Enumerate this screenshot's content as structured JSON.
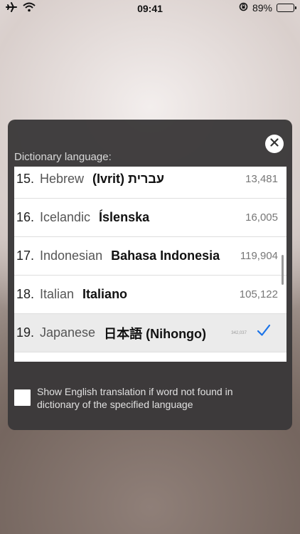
{
  "status_bar": {
    "time": "09:41",
    "battery_text": "89%",
    "battery_level": 0.89
  },
  "dialog": {
    "section_title": "Dictionary language:",
    "items": [
      {
        "num": "15.",
        "english": "Hebrew",
        "native": "(Ivrit) עברית",
        "count": "13,481"
      },
      {
        "num": "16.",
        "english": "Icelandic",
        "native": "Íslenska",
        "count": "16,005"
      },
      {
        "num": "17.",
        "english": "Indonesian",
        "native": "Bahasa Indonesia",
        "count": "119,904"
      },
      {
        "num": "18.",
        "english": "Italian",
        "native": "Italiano",
        "count": "105,122"
      },
      {
        "num": "19.",
        "english": "Japanese",
        "native": "日本語 (Nihongo)",
        "count": "342,037",
        "selected": true
      }
    ],
    "show_english_label": "Show English translation if word not found in dictionary of the specified language",
    "checkbox_checked": false
  },
  "colors": {
    "accent": "#1a73e8",
    "panel": "#3a3839"
  },
  "icons": [
    "airplane-icon",
    "wifi-icon",
    "orientation-lock-icon",
    "battery-icon",
    "close-icon",
    "checkmark-icon"
  ]
}
